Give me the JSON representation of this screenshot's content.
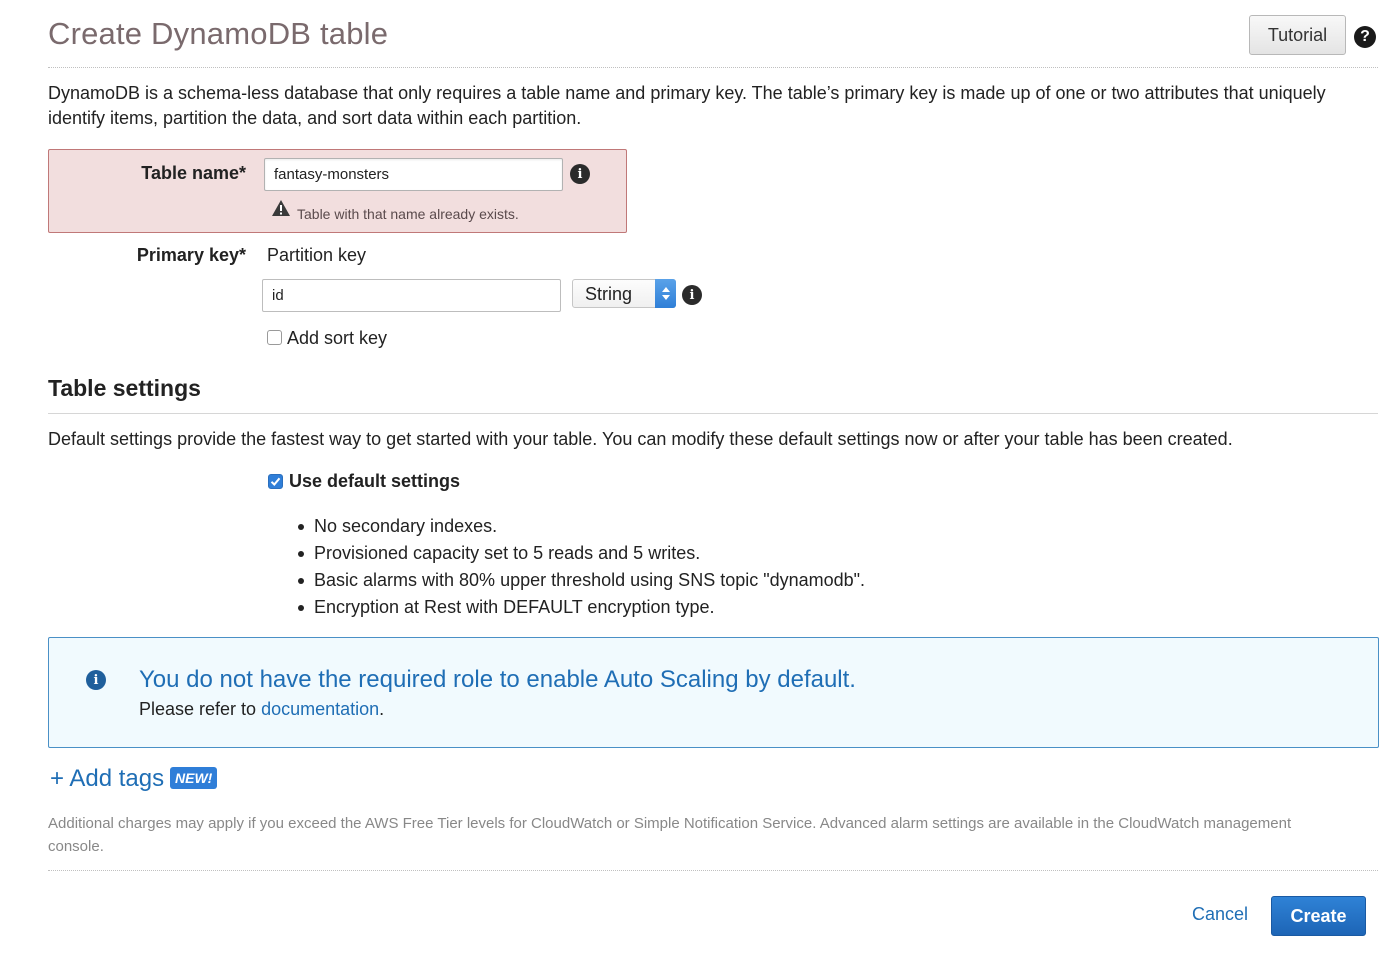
{
  "header": {
    "title": "Create DynamoDB table",
    "tutorial_label": "Tutorial",
    "help_icon": "help-question-icon"
  },
  "intro": "DynamoDB is a schema-less database that only requires a table name and primary key. The table’s primary key is made up of one or two attributes that uniquely identify items, partition the data, and sort data within each partition.",
  "table_name": {
    "label": "Table name*",
    "value": "fantasy-monsters",
    "error": "Table with that name already exists.",
    "info_icon": "info-icon",
    "warning_icon": "warning-icon"
  },
  "primary_key": {
    "label": "Primary key*",
    "partition_label": "Partition key",
    "partition_value": "id",
    "type_selected": "String",
    "add_sort_key_label": "Add sort key",
    "add_sort_key_checked": false
  },
  "table_settings": {
    "title": "Table settings",
    "description": "Default settings provide the fastest way to get started with your table. You can modify these default settings now or after your table has been created.",
    "use_default_label": "Use default settings",
    "use_default_checked": true,
    "bullets": [
      "No secondary indexes.",
      "Provisioned capacity set to 5 reads and 5 writes.",
      "Basic alarms with 80% upper threshold using SNS topic \"dynamodb\".",
      "Encryption at Rest with DEFAULT encryption type."
    ]
  },
  "autoscaling_notice": {
    "heading": "You do not have the required role to enable Auto Scaling by default.",
    "body_prefix": "Please refer to",
    "link_text": "documentation",
    "body_suffix": "."
  },
  "tags": {
    "add_label": "+ Add tags",
    "badge": "NEW!"
  },
  "footnote": "Additional charges may apply if you exceed the AWS Free Tier levels for CloudWatch or Simple Notification Service. Advanced alarm settings are available in the CloudWatch management console.",
  "actions": {
    "cancel_label": "Cancel",
    "create_label": "Create"
  },
  "colors": {
    "accent": "#1f6eb5",
    "error_bg": "#f2dede",
    "info_bg": "#f1fafe",
    "primary_button": "#2f7ed8"
  }
}
